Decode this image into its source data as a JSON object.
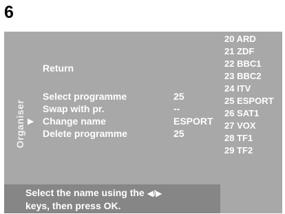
{
  "step_number": "6",
  "side_label": "Organiser",
  "menu": {
    "return_label": "Return",
    "rows": [
      {
        "label": "Select programme",
        "value": "25"
      },
      {
        "label": "Swap with pr.",
        "value": "--"
      },
      {
        "label": "Change name",
        "value": "ESPORT",
        "selected": true
      },
      {
        "label": "Delete programme",
        "value": "25"
      }
    ],
    "pointer_icon": "right-triangle-icon"
  },
  "hint": {
    "line1_before": "Select the name using the ",
    "arrows": "◀/▶",
    "line2": "keys, then press OK."
  },
  "programme_list": [
    "20 ARD",
    "21 ZDF",
    "22 BBC1",
    "23 BBC2",
    "24 ITV",
    "25 ESPORT",
    "26 SAT1",
    "27 VOX",
    "28 TF1",
    "29 TF2"
  ],
  "colors": {
    "panel": "#a8a8a8",
    "hint_panel": "#868686",
    "text": "#ffffff"
  }
}
